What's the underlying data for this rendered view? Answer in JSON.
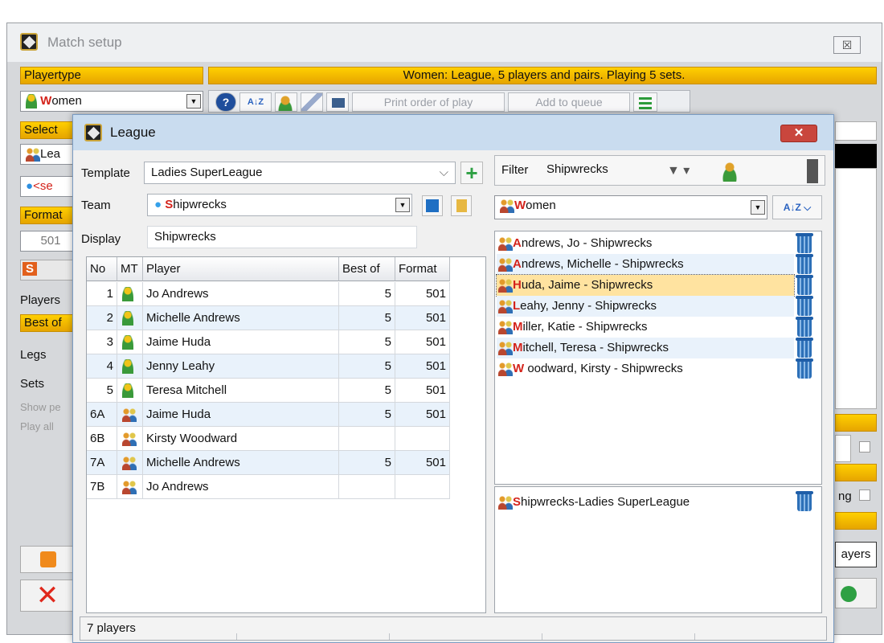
{
  "main": {
    "title": "Match setup",
    "close": "☒",
    "playertype_label": "Playertype",
    "banner": "Women: League, 5 players and pairs. Playing 5 sets.",
    "playertype_value_red": "W",
    "playertype_value": "omen",
    "toolbar": {
      "help": "?",
      "sort": "A↓Z",
      "print_order": "Print order of play",
      "add_queue": "Add to queue"
    },
    "left_fragments": [
      "Select ",
      "Lea",
      "<se",
      "Format",
      "501",
      "S",
      "Players",
      "Best of",
      "Legs",
      "Sets",
      "Show pe",
      "Play all"
    ],
    "right_fragments": [
      "ng",
      "ayers"
    ]
  },
  "dialog": {
    "title": "League",
    "close": "✕",
    "template_label": "Template",
    "template_value": "Ladies SuperLeague",
    "team_label": "Team",
    "team_value": "Shipwrecks",
    "display_label": "Display",
    "display_value": "Shipwrecks",
    "filter_label": "Filter",
    "filter_value": "Shipwrecks",
    "playertype_red": "W",
    "playertype_rest": "omen",
    "grid": {
      "headers": [
        "No",
        "MT",
        "Player",
        "Best of",
        "Format"
      ],
      "rows": [
        {
          "no": "1",
          "mt": "single",
          "player": "Jo Andrews",
          "best_of": "5",
          "format": "501"
        },
        {
          "no": "2",
          "mt": "single",
          "player": "Michelle Andrews",
          "best_of": "5",
          "format": "501"
        },
        {
          "no": "3",
          "mt": "single",
          "player": "Jaime Huda",
          "best_of": "5",
          "format": "501"
        },
        {
          "no": "4",
          "mt": "single",
          "player": "Jenny Leahy",
          "best_of": "5",
          "format": "501"
        },
        {
          "no": "5",
          "mt": "single",
          "player": "Teresa Mitchell",
          "best_of": "5",
          "format": "501"
        },
        {
          "no": "6A",
          "mt": "pair",
          "player": "Jaime Huda",
          "best_of": "5",
          "format": "501"
        },
        {
          "no": "6B",
          "mt": "pair",
          "player": "Kirsty Woodward",
          "best_of": "",
          "format": ""
        },
        {
          "no": "7A",
          "mt": "pair",
          "player": "Michelle Andrews",
          "best_of": "5",
          "format": "501"
        },
        {
          "no": "7B",
          "mt": "pair",
          "player": "Jo Andrews",
          "best_of": "",
          "format": ""
        }
      ]
    },
    "players": [
      {
        "initial": "A",
        "rest": "ndrews, Jo - Shipwrecks"
      },
      {
        "initial": "A",
        "rest": "ndrews, Michelle - Shipwrecks"
      },
      {
        "initial": "H",
        "rest": "uda, Jaime - Shipwrecks"
      },
      {
        "initial": "L",
        "rest": "eahy, Jenny - Shipwrecks"
      },
      {
        "initial": "M",
        "rest": "iller, Katie - Shipwrecks"
      },
      {
        "initial": "M",
        "rest": "itchell, Teresa - Shipwrecks"
      },
      {
        "initial": "W",
        "rest": " oodward, Kirsty - Shipwrecks"
      }
    ],
    "selected_player_index": 2,
    "team_template": {
      "initial": "S",
      "rest": "hipwrecks-Ladies SuperLeague"
    },
    "status": "7 players"
  },
  "colors": {
    "banner": "#ffcc00",
    "selected_row": "#ffe3a0",
    "alt_row": "#e9f2fb",
    "accent_red": "#d4231b"
  }
}
